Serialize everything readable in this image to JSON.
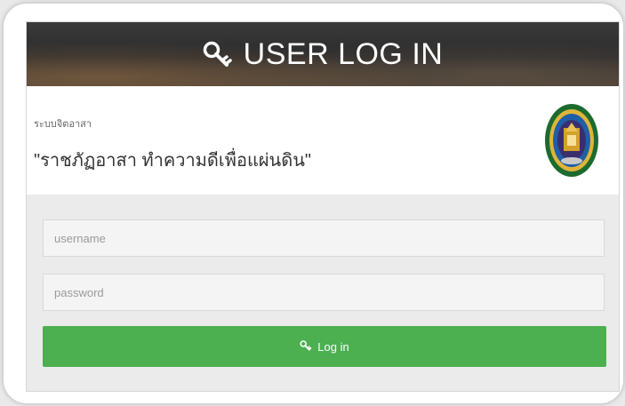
{
  "header": {
    "title": "USER LOG IN",
    "icon": "key-icon"
  },
  "brand": {
    "system_name": "ระบบจิตอาสา",
    "slogan": "\"ราชภัฏอาสา ทำความดีเพื่อแผ่นดิน\"",
    "logo": "university-seal-logo"
  },
  "form": {
    "username_placeholder": "username",
    "username_value": "",
    "password_placeholder": "password",
    "password_value": "",
    "login_label": "Log in",
    "login_icon": "key-icon"
  },
  "colors": {
    "login_button": "#4caf50",
    "header_bg": "#2f2f30",
    "panel_bg": "#ebebeb"
  }
}
